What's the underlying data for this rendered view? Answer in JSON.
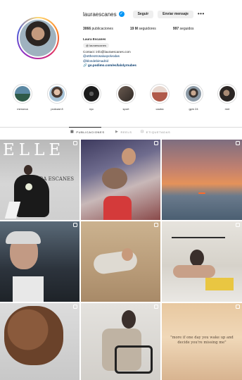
{
  "profile": {
    "username": "lauraescanes",
    "follow_label": "Seguir",
    "message_label": "Enviar mensaje",
    "more_label": "•••",
    "stats": {
      "posts_value": "3066",
      "posts_label": "publicaciones",
      "followers_value": "19 M",
      "followers_label": "seguidores",
      "following_value": "997",
      "following_label": "seguidos"
    },
    "bio": {
      "name": "Laura Escanes",
      "threads_label": "lauraescanes",
      "contact": "Contact: info@lauraescanes.com",
      "mention1": "@ottheotrosaluxpolvodas",
      "mention2": "@blondebimadrid",
      "link": "go.podimo.com/es/lalolyrnubes"
    }
  },
  "highlights": [
    {
      "label": "menorca",
      "color": "#3f6f8a"
    },
    {
      "label": "podcast 8",
      "color": "#c9a08a"
    },
    {
      "label": "nyc",
      "color": "#2a2a2a"
    },
    {
      "label": "sport",
      "color": "#4a3f3a"
    },
    {
      "label": "caoba",
      "color": "#b06a5a"
    },
    {
      "label": "gym 24",
      "color": "#7a8a96"
    },
    {
      "label": "mnt",
      "color": "#3a3533"
    }
  ],
  "tabs": [
    {
      "label": "PUBLICACIONES",
      "icon": "grid-icon"
    },
    {
      "label": "REELS",
      "icon": "reels-icon"
    },
    {
      "label": "ETIQUETADAS",
      "icon": "tagged-icon"
    }
  ],
  "posts": {
    "elle_logo": "ELLE",
    "elle_cover_name": "LAURA ESCANES",
    "quote_text": "\"more if one day you wake up and decide you're missing me\""
  }
}
